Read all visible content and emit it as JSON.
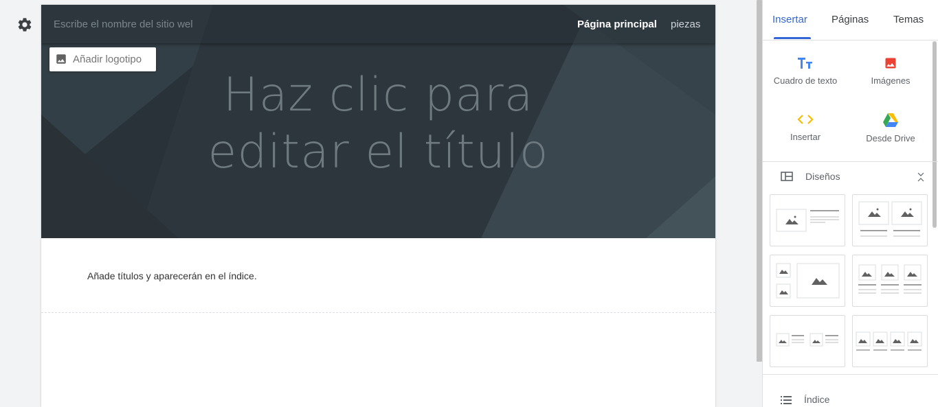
{
  "editor": {
    "settings_icon": "gear-icon"
  },
  "site": {
    "name_placeholder": "Escribe el nombre del sitio wel",
    "nav": {
      "home": "Página principal",
      "other": "piezas"
    },
    "logo_button": {
      "icon": "image-icon",
      "label": "Añadir logotipo"
    },
    "hero_title": "Haz clic para\neditar el título",
    "toc_text": "Añade títulos y aparecerán en el índice."
  },
  "panel": {
    "tabs": [
      {
        "label": "Insertar",
        "active": true
      },
      {
        "label": "Páginas",
        "active": false
      },
      {
        "label": "Temas",
        "active": false
      }
    ],
    "insert_items": [
      {
        "label": "Cuadro de texto",
        "icon": "text-box-icon",
        "color": "#4285f4"
      },
      {
        "label": "Imágenes",
        "icon": "image-icon",
        "color": "#ea4335"
      },
      {
        "label": "Insertar",
        "icon": "embed-icon",
        "color": "#fbbc04"
      },
      {
        "label": "Desde Drive",
        "icon": "google-drive-icon",
        "color": "#34a853"
      }
    ],
    "layouts_section": {
      "label": "Diseños",
      "icon": "layouts-icon",
      "expanded": true
    },
    "index_section": {
      "label": "Índice",
      "icon": "list-icon"
    }
  },
  "colors": {
    "accent": "#3367d6",
    "hero_bg": "#2f3a41"
  }
}
